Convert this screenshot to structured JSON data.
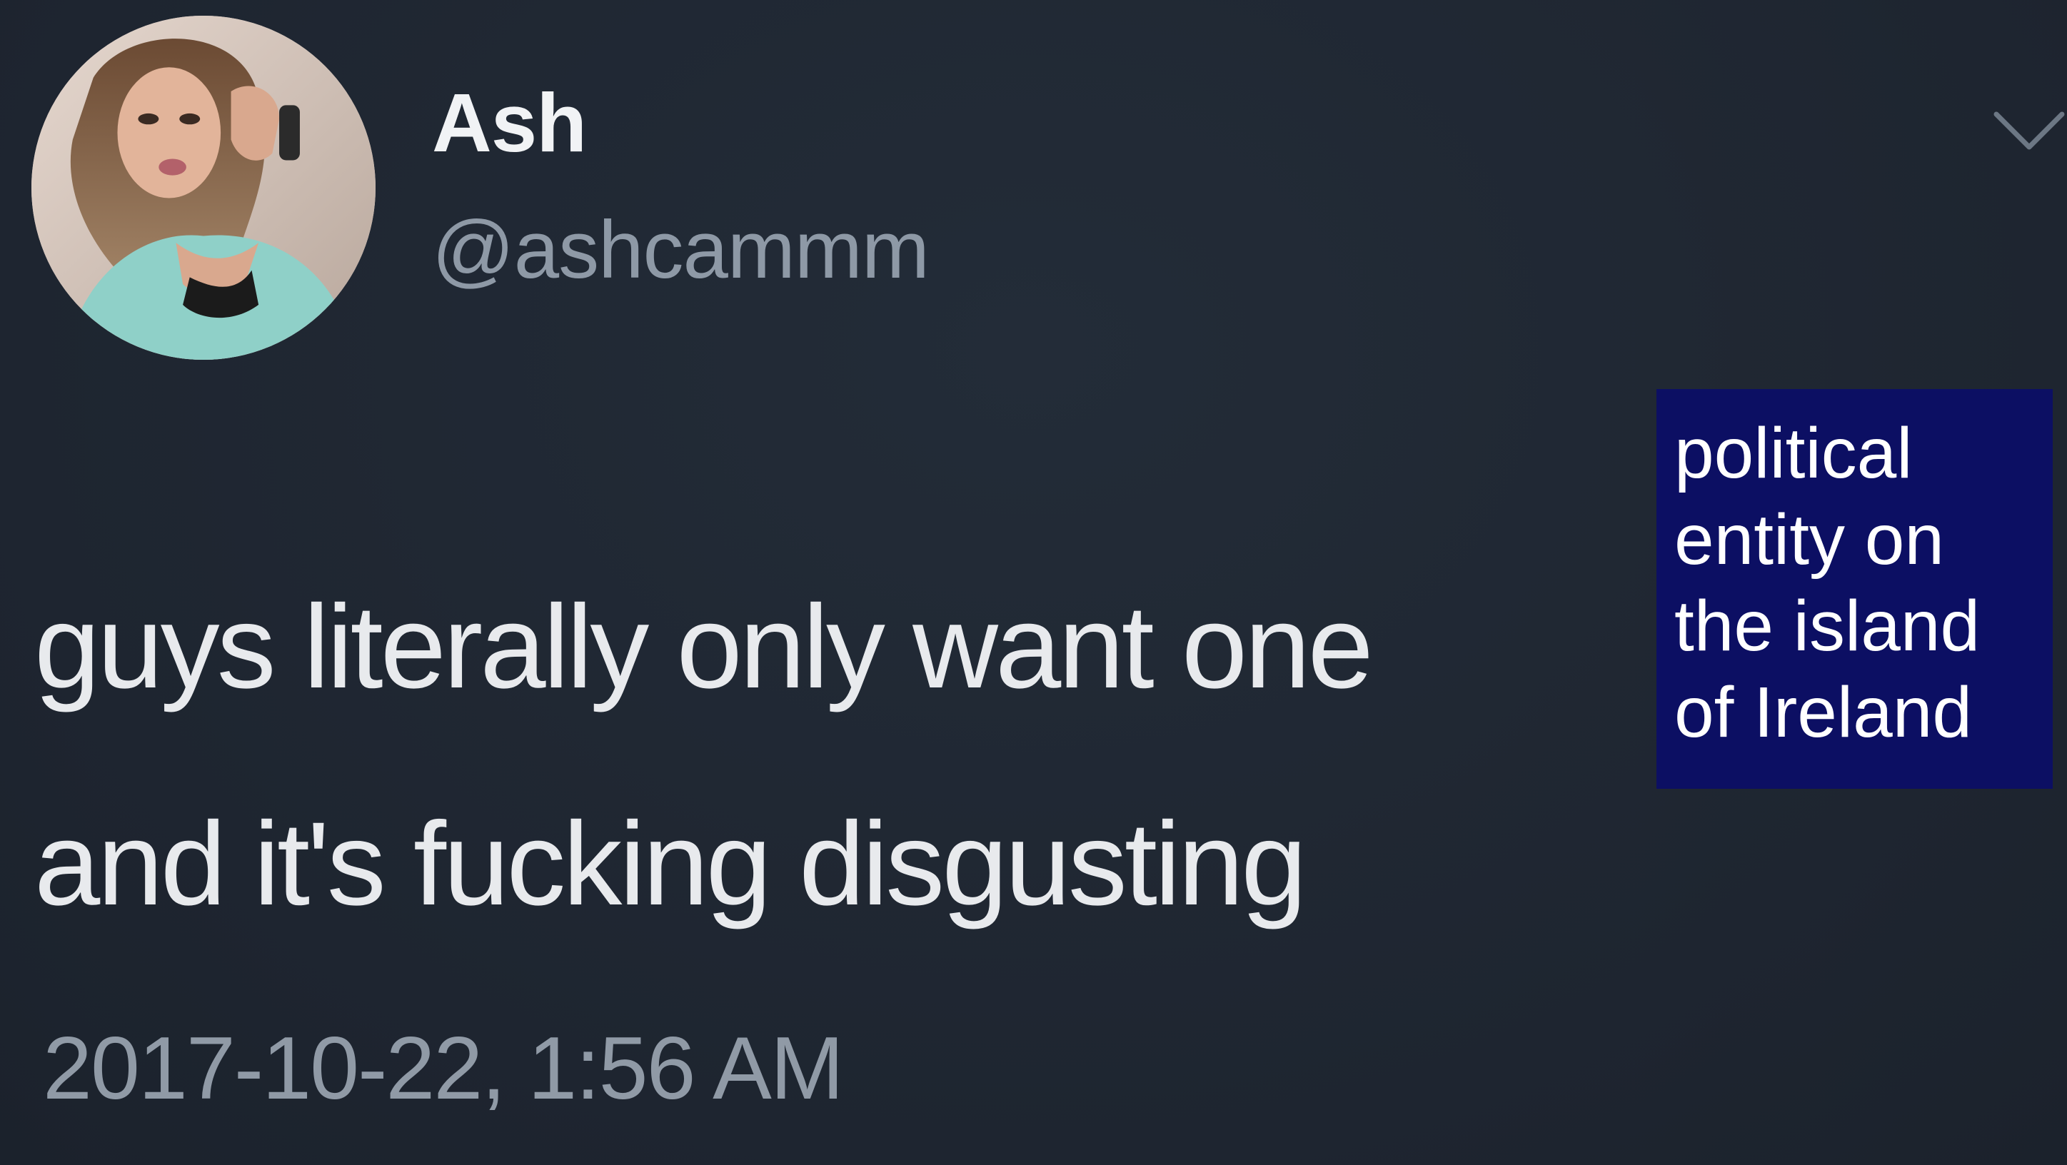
{
  "tweet": {
    "author": {
      "display_name": "Ash",
      "handle": "@ashcammm",
      "avatar_icon": "profile-photo"
    },
    "text_lines": [
      "guys literally only want one",
      "and it's fucking disgusting"
    ],
    "timestamp": "2017-10-22, 1:56 AM",
    "menu_icon": "chevron-down-icon"
  },
  "overlay_label": {
    "lines": [
      "political",
      "entity on",
      "the island",
      "of Ireland"
    ],
    "background_color": "#0c0f63"
  },
  "colors": {
    "background": "#1f2732",
    "text": "#e8eaed",
    "muted": "#909aa6"
  }
}
